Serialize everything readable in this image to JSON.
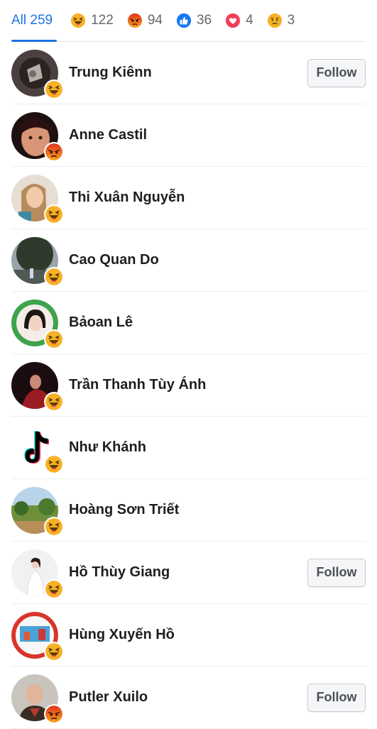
{
  "tabs": [
    {
      "label": "All 259",
      "active": true
    },
    {
      "icon": "laugh-reaction-icon",
      "count": "122"
    },
    {
      "icon": "angry-reaction-icon",
      "count": "94"
    },
    {
      "icon": "like-reaction-icon",
      "count": "36"
    },
    {
      "icon": "love-reaction-icon",
      "count": "4"
    },
    {
      "icon": "sad-reaction-icon",
      "count": "3"
    }
  ],
  "people": [
    {
      "name": "Trung Kiênn",
      "reaction": "laugh",
      "follow": "Follow"
    },
    {
      "name": "Anne Castil",
      "reaction": "angry",
      "follow": ""
    },
    {
      "name": "Thi Xuân Nguyễn",
      "reaction": "laugh",
      "follow": ""
    },
    {
      "name": "Cao Quan Do",
      "reaction": "laugh",
      "follow": ""
    },
    {
      "name": "Bảoan Lê",
      "reaction": "laugh",
      "follow": ""
    },
    {
      "name": "Trần Thanh Tùy Ánh",
      "reaction": "laugh",
      "follow": ""
    },
    {
      "name": "Như Khánh",
      "reaction": "laugh",
      "follow": ""
    },
    {
      "name": "Hoàng Sơn Triết",
      "reaction": "laugh",
      "follow": ""
    },
    {
      "name": "Hồ Thùy Giang",
      "reaction": "laugh",
      "follow": "Follow"
    },
    {
      "name": "Hùng Xuyến Hồ",
      "reaction": "laugh",
      "follow": ""
    },
    {
      "name": "Putler Xuilo",
      "reaction": "angry",
      "follow": "Follow"
    }
  ],
  "colors": {
    "accent": "#1b74e4",
    "laugh": "#f7b125",
    "angry": "#e9710f",
    "like": "#1877f2",
    "love": "#f33e58"
  }
}
